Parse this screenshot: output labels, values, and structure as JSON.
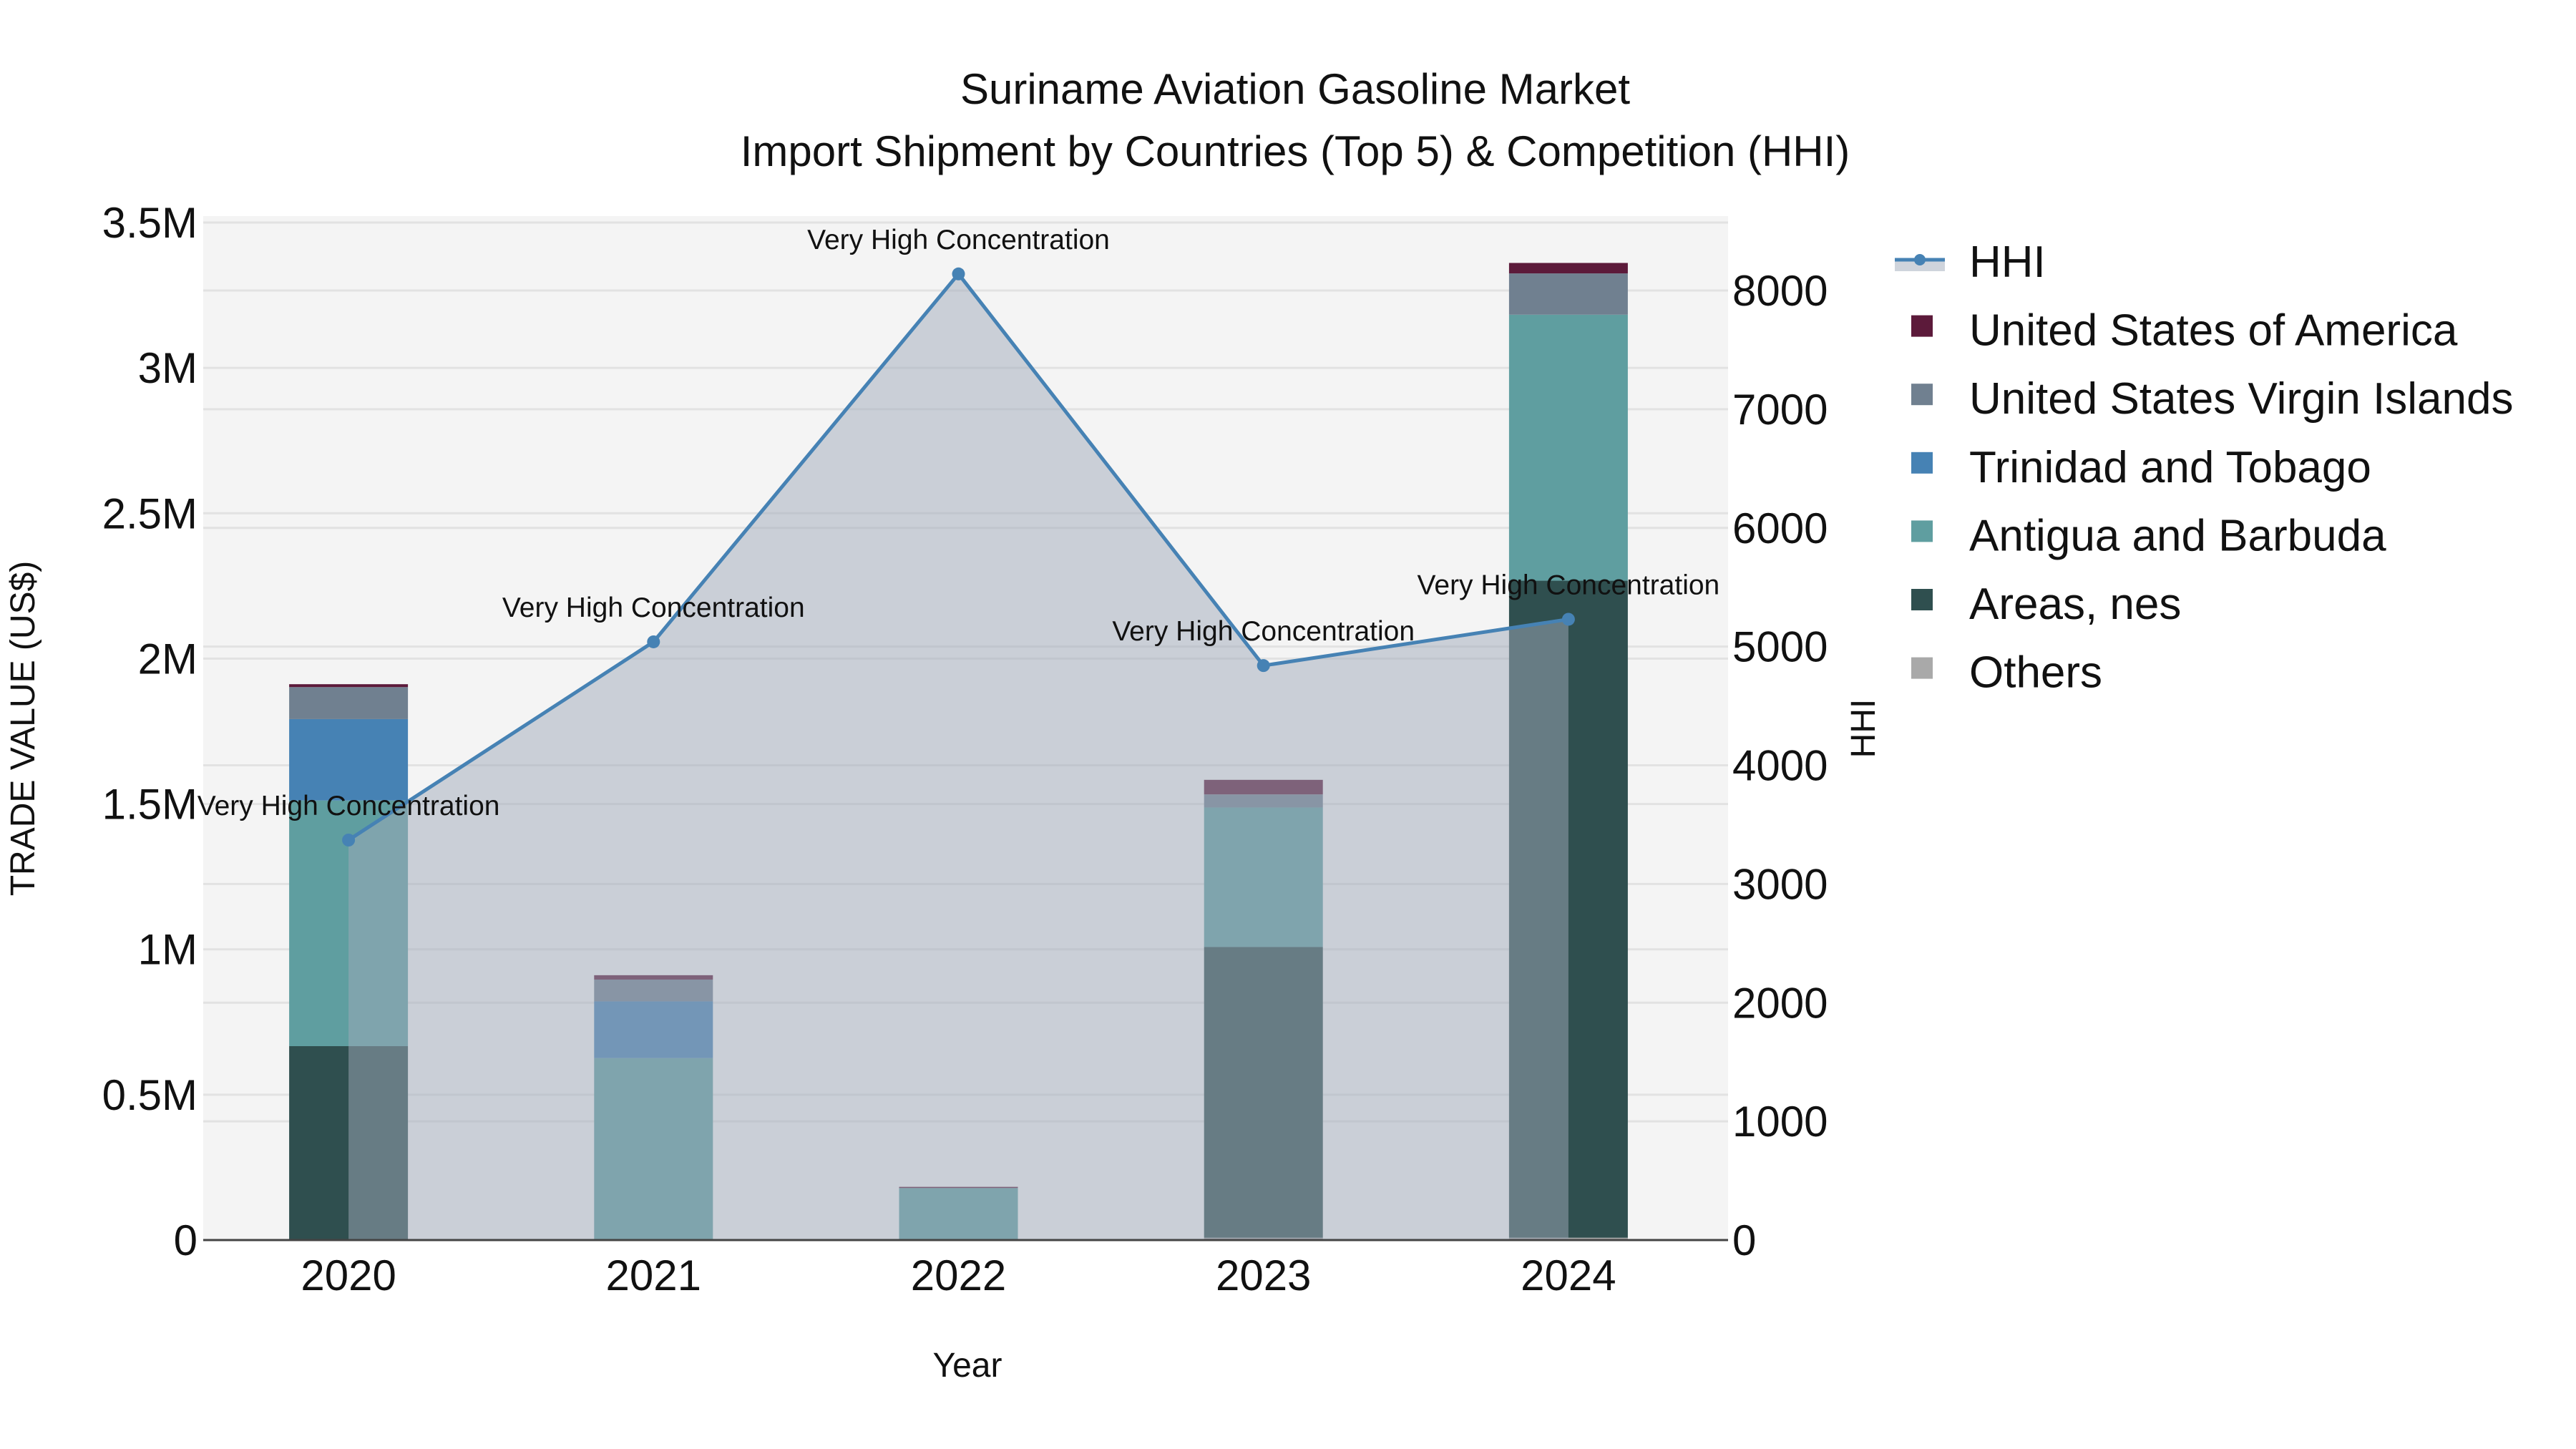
{
  "chart_data": {
    "type": "bar",
    "title": "Suriname Aviation Gasoline Market",
    "subtitle": "Import Shipment by Countries (Top 5) & Competition (HHI)",
    "xlabel": "Year",
    "ylabel": "TRADE VALUE (US$)",
    "y2label": "HHI",
    "categories": [
      "2020",
      "2021",
      "2022",
      "2023",
      "2024"
    ],
    "ylim": [
      0,
      3500000
    ],
    "y2lim": [
      0,
      8600
    ],
    "yticks": [
      0,
      500000,
      1000000,
      1500000,
      2000000,
      2500000,
      3000000,
      3500000
    ],
    "ytick_labels": [
      "0",
      "0.5M",
      "1M",
      "1.5M",
      "2M",
      "2.5M",
      "3M",
      "3.5M"
    ],
    "y2ticks": [
      0,
      1000,
      2000,
      3000,
      4000,
      5000,
      6000,
      7000,
      8000
    ],
    "y2tick_labels": [
      "0",
      "1000",
      "2000",
      "3000",
      "4000",
      "5000",
      "6000",
      "7000",
      "8000"
    ],
    "stacked": true,
    "grid": true,
    "legend_position": "right",
    "series": [
      {
        "name": "Others",
        "color": "#a9a9a9",
        "values": [
          2000,
          1000,
          1000,
          8000,
          8000
        ]
      },
      {
        "name": "Areas, nes",
        "color": "#2f4f4f",
        "values": [
          665000,
          0,
          0,
          1000000,
          2260000
        ]
      },
      {
        "name": "Antigua and Barbuda",
        "color": "#5f9ea0",
        "values": [
          845000,
          625000,
          178000,
          480000,
          915000
        ]
      },
      {
        "name": "Trinidad and Tobago",
        "color": "#4682b4",
        "values": [
          280000,
          195000,
          0,
          0,
          0
        ]
      },
      {
        "name": "United States Virgin Islands",
        "color": "#708090",
        "values": [
          110000,
          75000,
          0,
          45000,
          142000
        ]
      },
      {
        "name": "United States of America",
        "color": "#5c1a3a",
        "values": [
          10000,
          15000,
          4000,
          50000,
          36000
        ]
      }
    ],
    "hhi": {
      "name": "HHI",
      "color": "#4682b4",
      "values": [
        3370,
        5040,
        8140,
        4840,
        5230
      ],
      "annotations": [
        "Very High Concentration",
        "Very High Concentration",
        "Very High Concentration",
        "Very High Concentration",
        "Very High Concentration"
      ]
    },
    "legend_order": [
      "HHI",
      "United States of America",
      "United States Virgin Islands",
      "Trinidad and Tobago",
      "Antigua and Barbuda",
      "Areas, nes",
      "Others"
    ]
  }
}
